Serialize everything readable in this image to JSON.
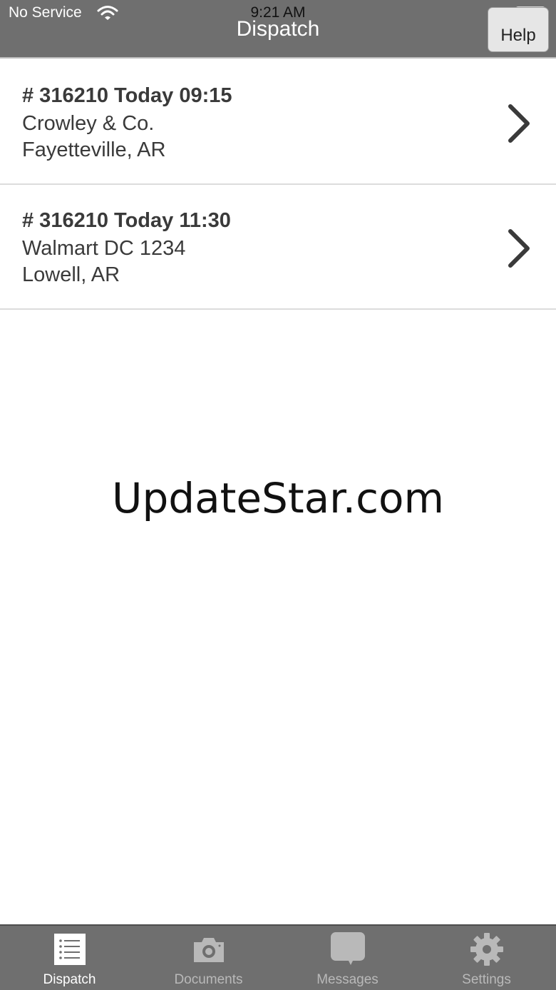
{
  "status_bar": {
    "carrier": "No Service",
    "time": "9:21 AM"
  },
  "header": {
    "title": "Dispatch",
    "help_label": "Help"
  },
  "dispatch_list": [
    {
      "line1": "# 316210 Today 09:15",
      "line2": "Crowley & Co.",
      "line3": "Fayetteville, AR"
    },
    {
      "line1": "# 316210 Today 11:30",
      "line2": "Walmart DC 1234",
      "line3": "Lowell, AR"
    }
  ],
  "watermark": "UpdateStar.com",
  "tabbar": {
    "tabs": [
      {
        "label": "Dispatch",
        "icon": "list-icon",
        "active": true
      },
      {
        "label": "Documents",
        "icon": "camera-icon",
        "active": false
      },
      {
        "label": "Messages",
        "icon": "chat-bubble-icon",
        "active": false
      },
      {
        "label": "Settings",
        "icon": "gear-icon",
        "active": false
      }
    ]
  },
  "colors": {
    "bar_background": "#6f6f6f",
    "active_tab_label": "#ffffff",
    "inactive_tab_label": "#b9b9b9",
    "battery_low": "#e53935"
  }
}
